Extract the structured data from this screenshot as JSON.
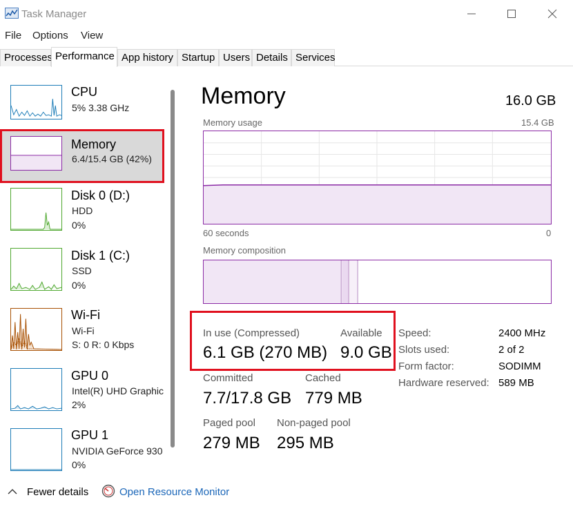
{
  "window": {
    "title": "Task Manager"
  },
  "menu": [
    "File",
    "Options",
    "View"
  ],
  "tabs": [
    "Processes",
    "Performance",
    "App history",
    "Startup",
    "Users",
    "Details",
    "Services"
  ],
  "active_tab": "Performance",
  "sidebar": {
    "items": [
      {
        "title": "CPU",
        "sub1": "5%  3.38 GHz",
        "sub2": "",
        "sub3": "",
        "color": "#1c7cb7"
      },
      {
        "title": "Memory",
        "sub1": "6.4/15.4 GB (42%)",
        "sub2": "",
        "sub3": "",
        "color": "#8b2aa5",
        "selected": true
      },
      {
        "title": "Disk 0 (D:)",
        "sub1": "HDD",
        "sub2": "0%",
        "sub3": "",
        "color": "#4ea72e"
      },
      {
        "title": "Disk 1 (C:)",
        "sub1": "SSD",
        "sub2": "0%",
        "sub3": "",
        "color": "#4ea72e"
      },
      {
        "title": "Wi-Fi",
        "sub1": "Wi-Fi",
        "sub2": "S: 0  R: 0 Kbps",
        "sub3": "",
        "color": "#a74f01"
      },
      {
        "title": "GPU 0",
        "sub1": "Intel(R) UHD Graphic",
        "sub2": "2%",
        "sub3": "",
        "color": "#1c7cb7"
      },
      {
        "title": "GPU 1",
        "sub1": "NVIDIA GeForce 930",
        "sub2": "0%",
        "sub3": "",
        "color": "#1c7cb7"
      }
    ]
  },
  "memory": {
    "title": "Memory",
    "total": "16.0 GB",
    "usage_label": "Memory usage",
    "usage_max": "15.4 GB",
    "graph_left": "60 seconds",
    "graph_right": "0",
    "usage_fraction": 0.42,
    "composition_label": "Memory composition",
    "in_use_label": "In use (Compressed)",
    "in_use_value": "6.1 GB (270 MB)",
    "available_label": "Available",
    "available_value": "9.0 GB",
    "committed_label": "Committed",
    "committed_value": "7.7/17.8 GB",
    "cached_label": "Cached",
    "cached_value": "779 MB",
    "paged_label": "Paged pool",
    "paged_value": "279 MB",
    "nonpaged_label": "Non-paged pool",
    "nonpaged_value": "295 MB",
    "specs": [
      {
        "label": "Speed:",
        "value": "2400 MHz"
      },
      {
        "label": "Slots used:",
        "value": "2 of 2"
      },
      {
        "label": "Form factor:",
        "value": "SODIMM"
      },
      {
        "label": "Hardware reserved:",
        "value": "589 MB"
      }
    ]
  },
  "footer": {
    "fewer_details": "Fewer details",
    "open_monitor": "Open Resource Monitor"
  },
  "colors": {
    "memory_accent": "#8b2aa5",
    "highlight": "#e0101e",
    "link": "#1a66b8"
  }
}
